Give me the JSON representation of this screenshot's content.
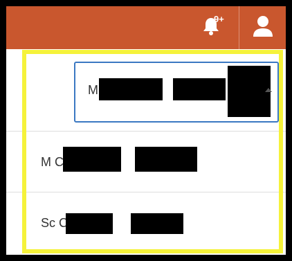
{
  "header": {
    "notifications": {
      "icon": "bell-icon",
      "badge": "9+"
    },
    "user_menu": {
      "icon": "user-icon"
    },
    "colors": {
      "bar": "#c9572e",
      "icon": "#ffffff"
    }
  },
  "select": {
    "selected_label": "M C",
    "caret_icon": "caret-up-icon",
    "border_color": "#3a78c2"
  },
  "dropdown": {
    "options": [
      {
        "label": "M C"
      },
      {
        "label": "Sc Co"
      }
    ]
  },
  "highlight": {
    "color": "#f5f23a"
  }
}
